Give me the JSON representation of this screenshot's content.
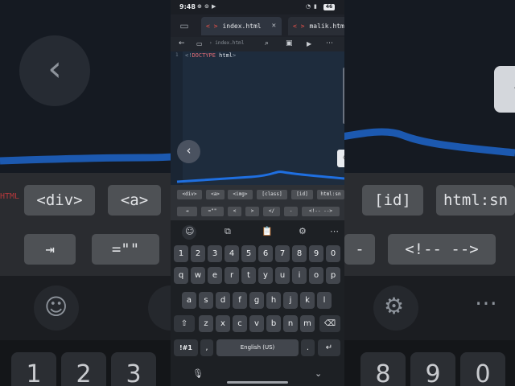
{
  "status": {
    "time": "9:48",
    "icons": [
      "⊕",
      "⊙",
      "▶"
    ],
    "battery": "46"
  },
  "tabs": [
    {
      "tag": "< >",
      "name": "index.html",
      "modified": "*",
      "active": true
    },
    {
      "tag": "< >",
      "name": "malik.html",
      "active": false
    }
  ],
  "toolbar": {
    "path": "index.html"
  },
  "editor": {
    "line_number": "1",
    "code": {
      "open": "<!",
      "doctype": "DOCTYPE",
      "rest": " html",
      "close": ">"
    }
  },
  "chips_row1": [
    "<div>",
    "<a>",
    "<img>",
    "[class]",
    "[id]",
    "html:sn"
  ],
  "chips_row2": [
    "⇥",
    "=\"\"",
    "<",
    ">",
    "</",
    "-",
    "<!-- -->"
  ],
  "keyboard": {
    "row1": [
      "1",
      "2",
      "3",
      "4",
      "5",
      "6",
      "7",
      "8",
      "9",
      "0"
    ],
    "row2": [
      "q",
      "w",
      "e",
      "r",
      "t",
      "y",
      "u",
      "i",
      "o",
      "p"
    ],
    "row3": [
      "a",
      "s",
      "d",
      "f",
      "g",
      "h",
      "j",
      "k",
      "l"
    ],
    "row4": [
      "z",
      "x",
      "c",
      "v",
      "b",
      "n",
      "m"
    ],
    "symbols": "!#1",
    "comma": ",",
    "space": "English (US)",
    "period": "."
  },
  "background": {
    "chips_row1": [
      "<div>",
      "<a>",
      "[id]",
      "html:sn"
    ],
    "chips_row2": [
      "⇥",
      "=\"\"",
      "-",
      "<!-- -->"
    ],
    "gutter_text": "HTML",
    "numbers": [
      "1",
      "2",
      "3",
      "8",
      "9",
      "0"
    ]
  },
  "colors": {
    "accent": "#e8524a",
    "wave": "#1f6fe0",
    "editor_bg": "#1e2c3d"
  }
}
